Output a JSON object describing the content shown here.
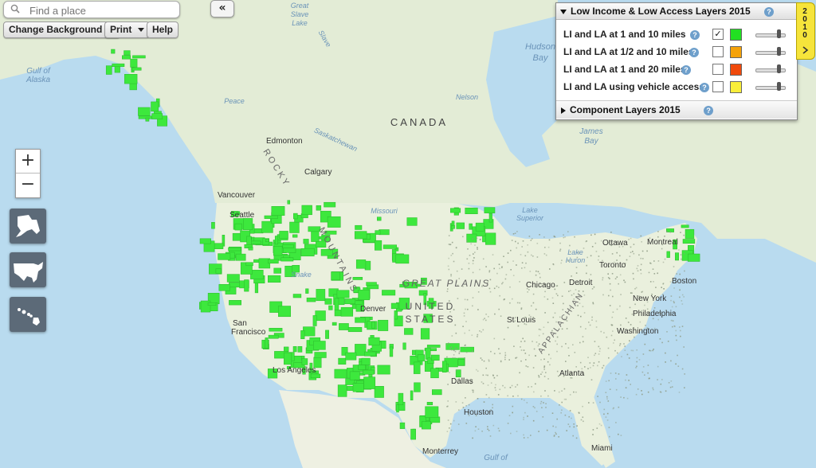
{
  "search": {
    "placeholder": "Find a place",
    "value": ""
  },
  "collapse_button": {
    "label": "«",
    "icon": "double-chevron-left-icon"
  },
  "toolbar": {
    "change_background": "Change Background",
    "print": "Print",
    "help": "Help"
  },
  "zoom": {
    "in": "+",
    "out": "−"
  },
  "region_buttons": [
    {
      "name": "alaska",
      "icon": "alaska-shape-icon"
    },
    {
      "name": "contiguous-us",
      "icon": "us-shape-icon"
    },
    {
      "name": "hawaii",
      "icon": "hawaii-islands-icon"
    }
  ],
  "layers_panel": {
    "title": "Low Income & Low Access Layers 2015",
    "layers": [
      {
        "label": "LI and LA at 1 and 10 miles",
        "checked": true,
        "checkmark": "✓",
        "color": "#22e022"
      },
      {
        "label": "LI and LA at 1/2 and 10 miles",
        "checked": false,
        "checkmark": "",
        "color": "#f5a20a"
      },
      {
        "label": "LI and LA at 1 and 20 miles",
        "checked": false,
        "checkmark": "",
        "color": "#f04a0c"
      },
      {
        "label": "LI and LA using vehicle access",
        "checked": false,
        "checkmark": "",
        "color": "#f9ee3a"
      }
    ],
    "component_title": "Component Layers 2015",
    "year_tab": [
      "2",
      "0",
      "1",
      "0"
    ]
  },
  "map_labels": {
    "countries": [
      "CANADA",
      "UNITED",
      "STATES"
    ],
    "regions": [
      "ROCKY",
      "MOUNTAINS",
      "GREAT PLAINS",
      "APPALACHIAN"
    ],
    "water": [
      "Gulf of Alaska",
      "Great Slave Lake",
      "Hudson Bay",
      "James Bay",
      "Lake Superior",
      "Lake Huron",
      "Gulf of Mexico",
      "Nelson",
      "Peace",
      "Saskatchewan",
      "Missouri",
      "Snake",
      "Slave"
    ],
    "cities": [
      "Edmonton",
      "Calgary",
      "Vancouver",
      "Seattle",
      "San Francisco",
      "Los Angeles",
      "Denver",
      "Dallas",
      "Houston",
      "Monterrey",
      "Chicago",
      "Detroit",
      "St Louis",
      "Atlanta",
      "Miami",
      "Toronto",
      "Ottawa",
      "Montreal",
      "Boston",
      "New York",
      "Philadelphia",
      "Washington"
    ]
  },
  "colors": {
    "water": "#b9dbef",
    "land": "#e7efd7",
    "canada": "#dde9d2",
    "highlight": "#3de83d"
  }
}
